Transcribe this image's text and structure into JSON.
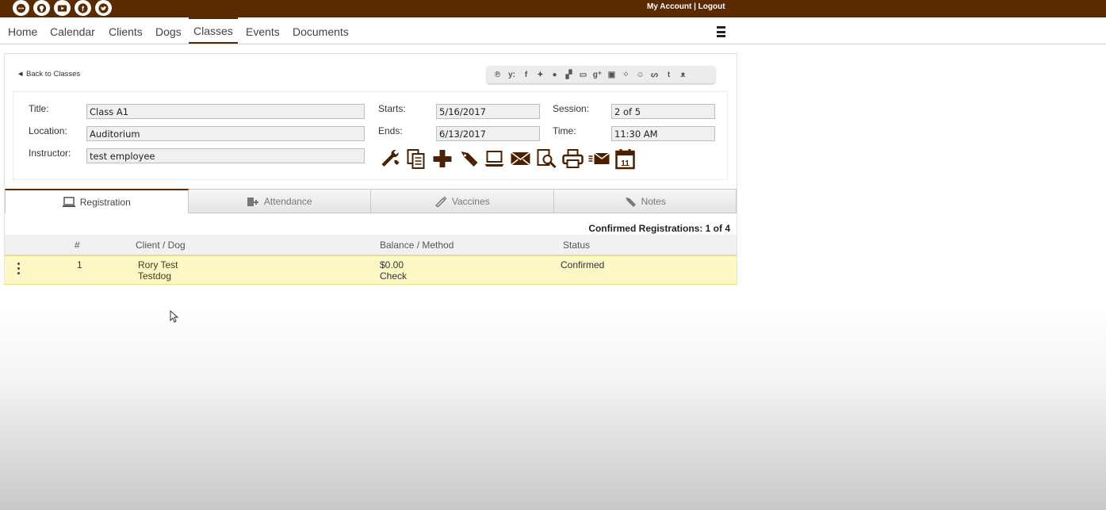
{
  "header": {
    "social_icons": [
      "chat-icon",
      "github-icon",
      "youtube-icon",
      "facebook-icon",
      "twitter-icon"
    ],
    "my_account": "My Account",
    "separator": " | ",
    "logout": "Logout",
    "brand_color": "#5b2a00"
  },
  "nav": {
    "items": [
      "Home",
      "Calendar",
      "Clients",
      "Dogs",
      "Classes",
      "Events",
      "Documents"
    ],
    "active": "Classes"
  },
  "page": {
    "back_link": "◄ Back to Classes",
    "share_icons": [
      "pinterest-icon",
      "yummly-icon",
      "facebook-icon",
      "twitter-icon",
      "blogger-icon",
      "delicious-icon",
      "digg-icon",
      "google-plus-icon",
      "linkedin-icon",
      "myspace-icon",
      "reddit-icon",
      "stumbleupon-icon",
      "tumblr-icon",
      "friends-icon"
    ],
    "form": {
      "title_label": "Title:",
      "title_value": "Class A1",
      "location_label": "Location:",
      "location_value": "Auditorium",
      "instructor_label": "Instructor:",
      "instructor_value": "test employee",
      "starts_label": "Starts:",
      "starts_value": "5/16/2017",
      "ends_label": "Ends:",
      "ends_value": "6/13/2017",
      "session_label": "Session:",
      "session_value": "2 of 5",
      "time_label": "Time:",
      "time_value": "11:30 AM"
    },
    "toolbar_icons": [
      "tools-icon",
      "copy-icon",
      "add-icon",
      "edit-pen-icon",
      "laptop-icon",
      "email-icon",
      "search-document-icon",
      "print-icon",
      "email-forward-icon",
      "calendar-icon"
    ],
    "calendar_day": "11"
  },
  "tabs": [
    {
      "label": "Registration",
      "icon": "laptop-icon",
      "active": true
    },
    {
      "label": "Attendance",
      "icon": "clipboard-add-icon",
      "active": false
    },
    {
      "label": "Vaccines",
      "icon": "syringe-icon",
      "active": false
    },
    {
      "label": "Notes",
      "icon": "pen-icon",
      "active": false
    }
  ],
  "registrations": {
    "summary": "Confirmed Registrations: 1 of 4",
    "columns": [
      "#",
      "Client / Dog",
      "Balance / Method",
      "Status"
    ],
    "rows": [
      {
        "num": "1",
        "client": "Rory Test",
        "dog": "Testdog",
        "balance": "$0.00",
        "method": "Check",
        "status": "Confirmed"
      }
    ]
  }
}
